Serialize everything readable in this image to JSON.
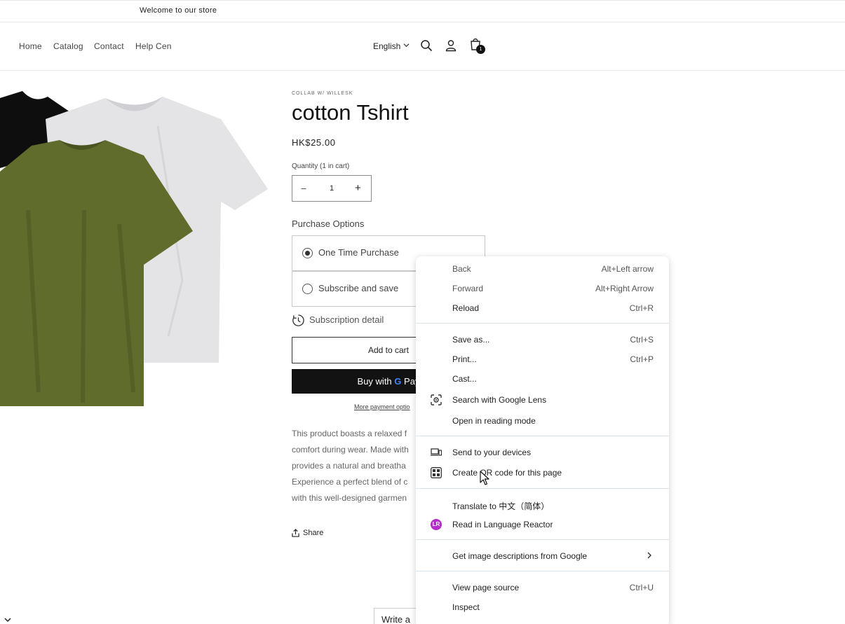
{
  "announcement": "Welcome to our store",
  "nav": [
    "Home",
    "Catalog",
    "Contact",
    "Help Cen"
  ],
  "header": {
    "language": "English",
    "cart_count": "1"
  },
  "product": {
    "vendor": "COLLAB W/ WILLESK",
    "title": "cotton Tshirt",
    "price": "HK$25.00",
    "quantity_label": "Quantity (1 in cart)",
    "quantity": "1",
    "minus": "−",
    "plus": "+",
    "purchase_options_label": "Purchase Options",
    "options": [
      "One Time Purchase",
      "Subscribe and save"
    ],
    "selected_option": "One Time Purchase",
    "subscription_detail": "Subscription detail",
    "add_to_cart": "Add to cart",
    "buy_with_prefix": "Buy with",
    "buy_with_brand": "Pay",
    "more_payment": "More payment optio",
    "description_lines": [
      "This product boasts a relaxed f",
      "comfort during wear. Made with",
      "provides a natural and breatha",
      "Experience a perfect blend of c",
      "with this well-designed garmen"
    ],
    "share": "Share",
    "write_review": "Write a"
  },
  "context_menu": {
    "groups": [
      [
        {
          "label": "Back",
          "shortcut": "Alt+Left arrow",
          "dim": true
        },
        {
          "label": "Forward",
          "shortcut": "Alt+Right Arrow",
          "dim": true
        },
        {
          "label": "Reload",
          "shortcut": "Ctrl+R"
        }
      ],
      [
        {
          "label": "Save as...",
          "shortcut": "Ctrl+S"
        },
        {
          "label": "Print...",
          "shortcut": "Ctrl+P"
        },
        {
          "label": "Cast..."
        },
        {
          "label": "Search with Google Lens",
          "icon": "google-lens-icon"
        },
        {
          "label": "Open in reading mode"
        }
      ],
      [
        {
          "label": "Send to your devices",
          "icon": "send-to-devices-icon"
        },
        {
          "label": "Create QR code for this page",
          "icon": "qr-code-icon"
        }
      ],
      [
        {
          "label": "Translate to 中文（简体）"
        },
        {
          "label": "Read in Language Reactor",
          "icon": "language-reactor-icon",
          "icon_text": "LR"
        }
      ],
      [
        {
          "label": "Get image descriptions from Google",
          "submenu": true
        }
      ],
      [
        {
          "label": "View page source",
          "shortcut": "Ctrl+U"
        },
        {
          "label": "Inspect"
        }
      ]
    ]
  }
}
